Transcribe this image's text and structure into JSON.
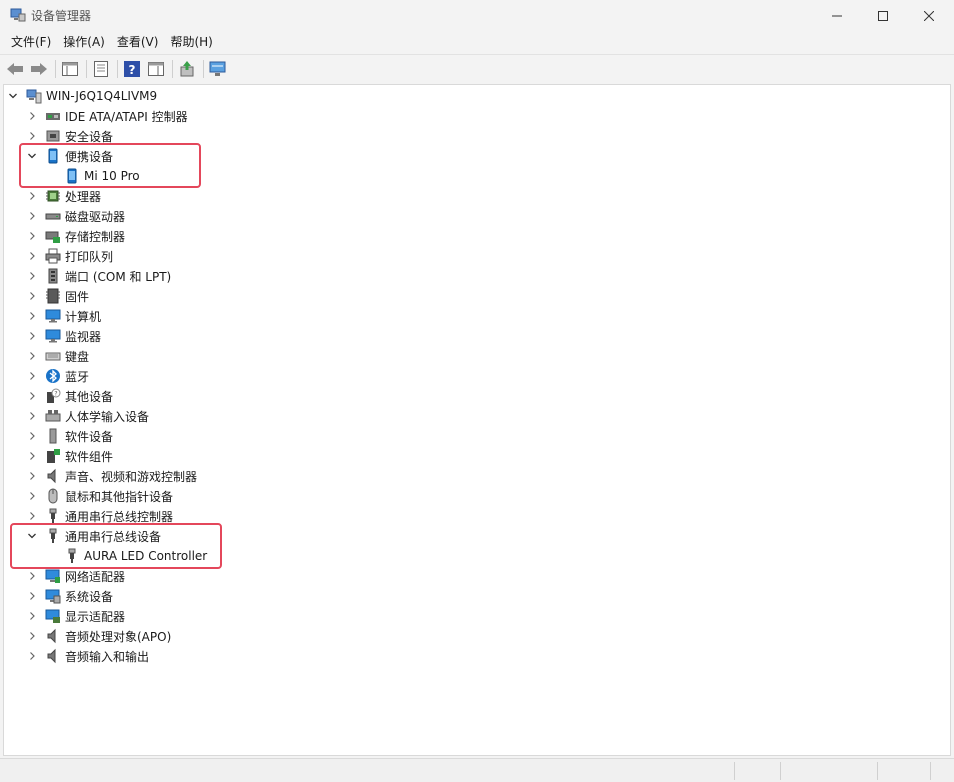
{
  "window": {
    "title": "设备管理器",
    "controls": {
      "minimize": "—",
      "maximize": "☐",
      "close": "✕"
    }
  },
  "menu": [
    {
      "label": "文件(F)"
    },
    {
      "label": "操作(A)"
    },
    {
      "label": "查看(V)"
    },
    {
      "label": "帮助(H)"
    }
  ],
  "toolbar": [
    {
      "icon": "back-arrow-icon"
    },
    {
      "icon": "forward-arrow-icon"
    },
    {
      "icon": "show-hide-tree-icon"
    },
    {
      "icon": "properties-icon"
    },
    {
      "icon": "help-icon"
    },
    {
      "icon": "action-pane-icon"
    },
    {
      "icon": "update-driver-icon"
    },
    {
      "icon": "scan-hardware-icon"
    }
  ],
  "tree": {
    "root": "WIN-J6Q1Q4LIVM9",
    "categories": [
      {
        "label": "IDE ATA/ATAPI 控制器",
        "icon": "ide-controller-icon",
        "expanded": false
      },
      {
        "label": "安全设备",
        "icon": "security-device-icon",
        "expanded": false
      },
      {
        "label": "便携设备",
        "icon": "portable-device-icon",
        "expanded": true,
        "children": [
          {
            "label": "Mi 10 Pro",
            "icon": "phone-icon"
          }
        ]
      },
      {
        "label": "处理器",
        "icon": "processor-icon",
        "expanded": false
      },
      {
        "label": "磁盘驱动器",
        "icon": "disk-drive-icon",
        "expanded": false
      },
      {
        "label": "存储控制器",
        "icon": "storage-controller-icon",
        "expanded": false
      },
      {
        "label": "打印队列",
        "icon": "printer-icon",
        "expanded": false
      },
      {
        "label": "端口 (COM 和 LPT)",
        "icon": "port-icon",
        "expanded": false
      },
      {
        "label": "固件",
        "icon": "firmware-icon",
        "expanded": false
      },
      {
        "label": "计算机",
        "icon": "computer-icon",
        "expanded": false
      },
      {
        "label": "监视器",
        "icon": "monitor-icon",
        "expanded": false
      },
      {
        "label": "键盘",
        "icon": "keyboard-icon",
        "expanded": false
      },
      {
        "label": "蓝牙",
        "icon": "bluetooth-icon",
        "expanded": false
      },
      {
        "label": "其他设备",
        "icon": "unknown-device-icon",
        "expanded": false
      },
      {
        "label": "人体学输入设备",
        "icon": "hid-icon",
        "expanded": false
      },
      {
        "label": "软件设备",
        "icon": "software-device-icon",
        "expanded": false
      },
      {
        "label": "软件组件",
        "icon": "software-component-icon",
        "expanded": false
      },
      {
        "label": "声音、视频和游戏控制器",
        "icon": "sound-icon",
        "expanded": false
      },
      {
        "label": "鼠标和其他指针设备",
        "icon": "mouse-icon",
        "expanded": false
      },
      {
        "label": "通用串行总线控制器",
        "icon": "usb-icon",
        "expanded": false
      },
      {
        "label": "通用串行总线设备",
        "icon": "usb-icon",
        "expanded": true,
        "children": [
          {
            "label": "AURA LED Controller",
            "icon": "usb-icon"
          }
        ]
      },
      {
        "label": "网络适配器",
        "icon": "network-adapter-icon",
        "expanded": false
      },
      {
        "label": "系统设备",
        "icon": "system-device-icon",
        "expanded": false
      },
      {
        "label": "显示适配器",
        "icon": "display-adapter-icon",
        "expanded": false
      },
      {
        "label": "音频处理对象(APO)",
        "icon": "sound-icon",
        "expanded": false
      },
      {
        "label": "音频输入和输出",
        "icon": "sound-icon",
        "expanded": false
      }
    ]
  },
  "colors": {
    "highlight": "#e4475b",
    "accent": "#1a73c8"
  }
}
